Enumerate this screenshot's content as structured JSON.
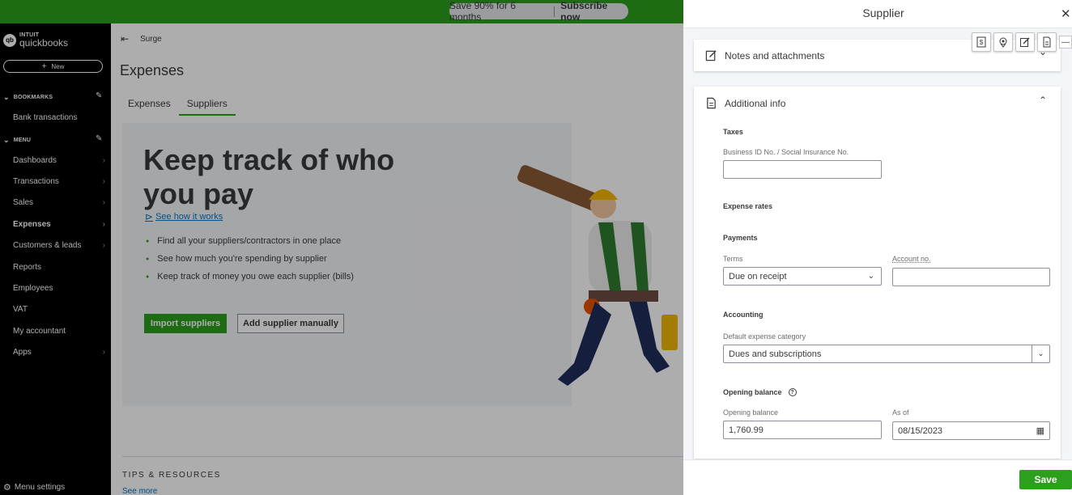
{
  "promo": {
    "text": "Save 90% for 6 months",
    "cta": "Subscribe now"
  },
  "sidebar": {
    "brand_top": "INTUIT",
    "brand": "quickbooks",
    "logo_glyph": "qb",
    "new_label": "New",
    "bookmarks_label": "BOOKMARKS",
    "bookmark_items": [
      "Bank transactions"
    ],
    "menu_label": "MENU",
    "items": [
      {
        "label": "Dashboards",
        "arrow": true
      },
      {
        "label": "Transactions",
        "arrow": true
      },
      {
        "label": "Sales",
        "arrow": true
      },
      {
        "label": "Expenses",
        "arrow": true
      },
      {
        "label": "Customers & leads",
        "arrow": true
      },
      {
        "label": "Reports",
        "arrow": false
      },
      {
        "label": "Employees",
        "arrow": false
      },
      {
        "label": "VAT",
        "arrow": false
      },
      {
        "label": "My accountant",
        "arrow": false
      },
      {
        "label": "Apps",
        "arrow": true
      }
    ],
    "menu_settings": "Menu settings"
  },
  "main": {
    "company": "Surge",
    "title": "Expenses",
    "tabs": [
      "Expenses",
      "Suppliers"
    ],
    "hero_title": "Keep track of who you pay",
    "see_how": "See how it works",
    "bullets": [
      "Find all your suppliers/contractors in one place",
      "See how much you're spending by supplier",
      "Keep track of money you owe each supplier (bills)"
    ],
    "import_btn": "Import suppliers",
    "add_btn": "Add supplier manually",
    "tips": "TIPS & RESOURCES",
    "see_more": "See more"
  },
  "drawer": {
    "title": "Supplier",
    "notes_label": "Notes and attachments",
    "additional_label": "Additional info",
    "taxes_label": "Taxes",
    "business_id_label": "Business ID No. / Social Insurance No.",
    "business_id_value": "",
    "expense_rates_label": "Expense rates",
    "payments_label": "Payments",
    "terms_label": "Terms",
    "terms_value": "Due on receipt",
    "account_no_label": "Account no.",
    "account_no_value": "",
    "accounting_label": "Accounting",
    "default_expense_label": "Default expense category",
    "default_expense_value": "Dues and subscriptions",
    "opening_balance_section": "Opening balance",
    "opening_balance_label": "Opening balance",
    "opening_balance_value": "1,760.99",
    "as_of_label": "As of",
    "as_of_value": "08/15/2023",
    "save_label": "Save"
  },
  "colors": {
    "brand_green": "#2ca01c",
    "link_blue": "#0077c5",
    "sidebar_bg": "#000000"
  }
}
